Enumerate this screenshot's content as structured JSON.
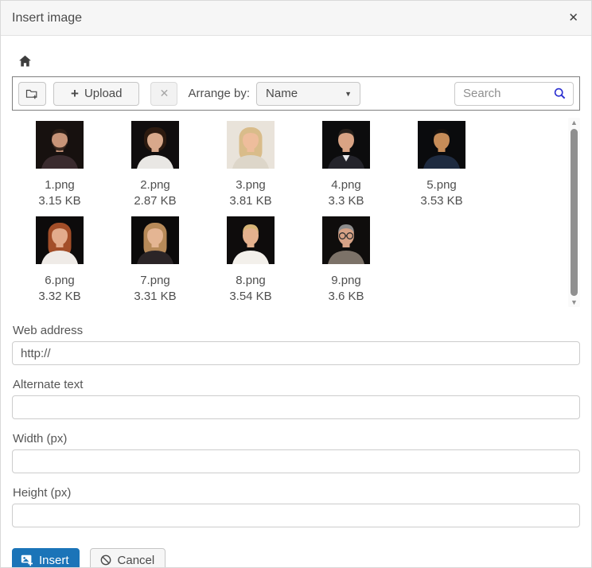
{
  "colors": {
    "primary": "#1b74b8",
    "search_icon": "#2b2fd0",
    "toolbar_border": "#7f7f7f"
  },
  "dialog": {
    "title": "Insert image",
    "close_glyph": "✕"
  },
  "breadcrumb": {
    "home_icon": "home"
  },
  "toolbar": {
    "create_folder_icon": "folder-plus",
    "upload_plus_glyph": "+",
    "upload_label": "Upload",
    "clear_selection_glyph": "✕",
    "arrange_by_label": "Arrange by:",
    "sort_value": "Name",
    "sort_caret_glyph": "▼",
    "search_placeholder": "Search",
    "search_icon": "magnifier"
  },
  "file_list": {
    "scrollbar": {
      "up_glyph": "▲",
      "down_glyph": "▼"
    },
    "files": [
      {
        "name": "1.png",
        "size": "3.15 KB",
        "avatar": {
          "bg": "#17110f",
          "skin": "#c79478",
          "hair": "#2a1d16",
          "shirt": "#3a2b2e",
          "style": "short",
          "beard": true
        }
      },
      {
        "name": "2.png",
        "size": "2.87 KB",
        "avatar": {
          "bg": "#100d0e",
          "skin": "#d8a88b",
          "hair": "#2c1a10",
          "shirt": "#e9e7e4",
          "style": "bob"
        }
      },
      {
        "name": "3.png",
        "size": "3.81 KB",
        "avatar": {
          "bg": "#e9e3da",
          "skin": "#eebd9c",
          "hair": "#d9bc8a",
          "shirt": "#ddd6c9",
          "style": "long"
        }
      },
      {
        "name": "4.png",
        "size": "3.3 KB",
        "avatar": {
          "bg": "#0c0c0d",
          "skin": "#d9a384",
          "hair": "#27201b",
          "shirt": "#24242b",
          "style": "short",
          "collar": true
        }
      },
      {
        "name": "5.png",
        "size": "3.53 KB",
        "avatar": {
          "bg": "#0a0b0d",
          "skin": "#c68c58",
          "hair": "#15100d",
          "shirt": "#1e2b40",
          "style": "short"
        }
      },
      {
        "name": "6.png",
        "size": "3.32 KB",
        "avatar": {
          "bg": "#0d0b0b",
          "skin": "#e3ac8c",
          "hair": "#a34e28",
          "shirt": "#efebe7",
          "style": "long"
        }
      },
      {
        "name": "7.png",
        "size": "3.31 KB",
        "avatar": {
          "bg": "#0b0a0a",
          "skin": "#e4b593",
          "hair": "#b78a59",
          "shirt": "#2b2527",
          "style": "long"
        }
      },
      {
        "name": "8.png",
        "size": "3.54 KB",
        "avatar": {
          "bg": "#0e0c0c",
          "skin": "#e4b18e",
          "hair": "#d7b577",
          "shirt": "#f3f0eb",
          "style": "updo"
        }
      },
      {
        "name": "9.png",
        "size": "3.6 KB",
        "avatar": {
          "bg": "#0f0d0c",
          "skin": "#d7a286",
          "hair": "#8d8d8d",
          "shirt": "#7c7268",
          "style": "short",
          "glasses": true
        }
      }
    ]
  },
  "form": {
    "fields": [
      {
        "label": "Web address",
        "value": "http://"
      },
      {
        "label": "Alternate text",
        "value": ""
      },
      {
        "label": "Width (px)",
        "value": ""
      },
      {
        "label": "Height (px)",
        "value": ""
      }
    ]
  },
  "footer": {
    "insert_label": "Insert",
    "cancel_label": "Cancel"
  }
}
